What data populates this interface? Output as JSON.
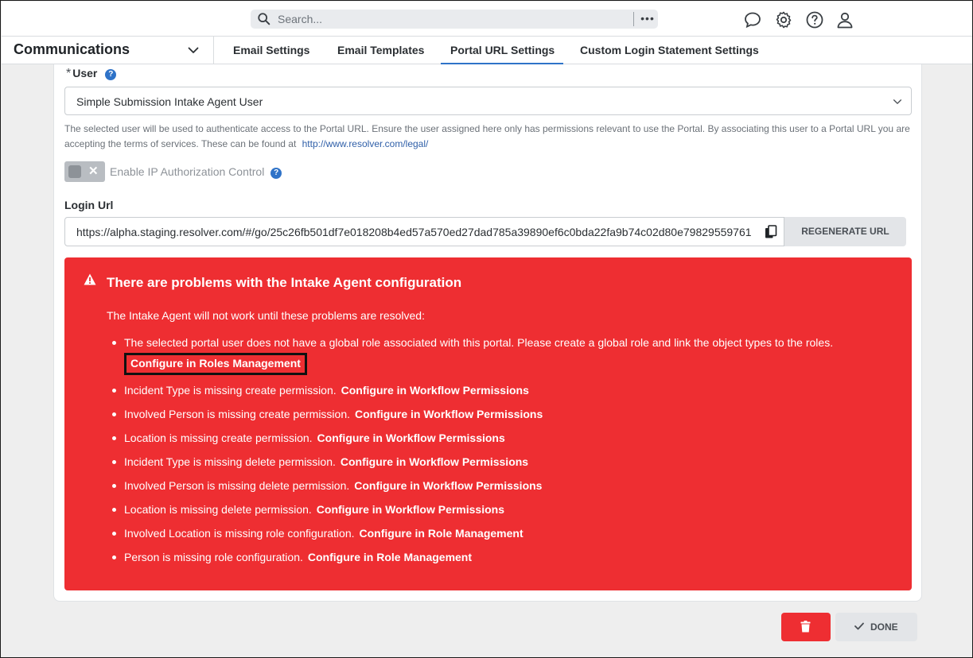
{
  "search": {
    "placeholder": "Search..."
  },
  "header_icons": [
    "chat-icon",
    "gear-icon",
    "help-icon",
    "user-icon"
  ],
  "app": {
    "title": "Communications"
  },
  "tabs": [
    {
      "label": "Email Settings",
      "active": false
    },
    {
      "label": "Email Templates",
      "active": false
    },
    {
      "label": "Portal URL Settings",
      "active": true
    },
    {
      "label": "Custom Login Statement Settings",
      "active": false
    }
  ],
  "user_field": {
    "required_mark": "*",
    "label": "User",
    "value": "Simple Submission Intake Agent User",
    "help": "?"
  },
  "description": {
    "text": "The selected user will be used to authenticate access to the Portal URL. Ensure the user assigned here only has permissions relevant to use the Portal. By associating this user to a Portal URL you are accepting the terms of services. These can be found at",
    "link": "http://www.resolver.com/legal/"
  },
  "ip_toggle": {
    "label": "Enable IP Authorization Control",
    "enabled": false,
    "help": "?"
  },
  "login_url": {
    "label": "Login Url",
    "value": "https://alpha.staging.resolver.com/#/go/25c26fb501df7e018208b4ed57a570ed27dad785a39890ef6c0bda22fa9b74c02d80e79829559761",
    "regenerate_label": "REGENERATE URL"
  },
  "error": {
    "title": "There are problems with the Intake Agent configuration",
    "intro": "The Intake Agent will not work until these problems are resolved:",
    "items": [
      {
        "text": "The selected portal user does not have a global role associated with this portal. Please create a global role and link the object types to the roles.",
        "link": "Configure in Roles Management"
      },
      {
        "text": "Incident Type is missing create permission.",
        "link": "Configure in Workflow Permissions"
      },
      {
        "text": "Involved Person is missing create permission.",
        "link": "Configure in Workflow Permissions"
      },
      {
        "text": "Location is missing create permission.",
        "link": "Configure in Workflow Permissions"
      },
      {
        "text": "Incident Type is missing delete permission.",
        "link": "Configure in Workflow Permissions"
      },
      {
        "text": "Involved Person is missing delete permission.",
        "link": "Configure in Workflow Permissions"
      },
      {
        "text": "Location is missing delete permission.",
        "link": "Configure in Workflow Permissions"
      },
      {
        "text": "Involved Location is missing role configuration.",
        "link": "Configure in Role Management"
      },
      {
        "text": "Person is missing role configuration.",
        "link": "Configure in Role Management"
      }
    ]
  },
  "actions": {
    "done_label": "DONE"
  },
  "colors": {
    "accent": "#2f73c8",
    "error": "#ee2e32"
  }
}
